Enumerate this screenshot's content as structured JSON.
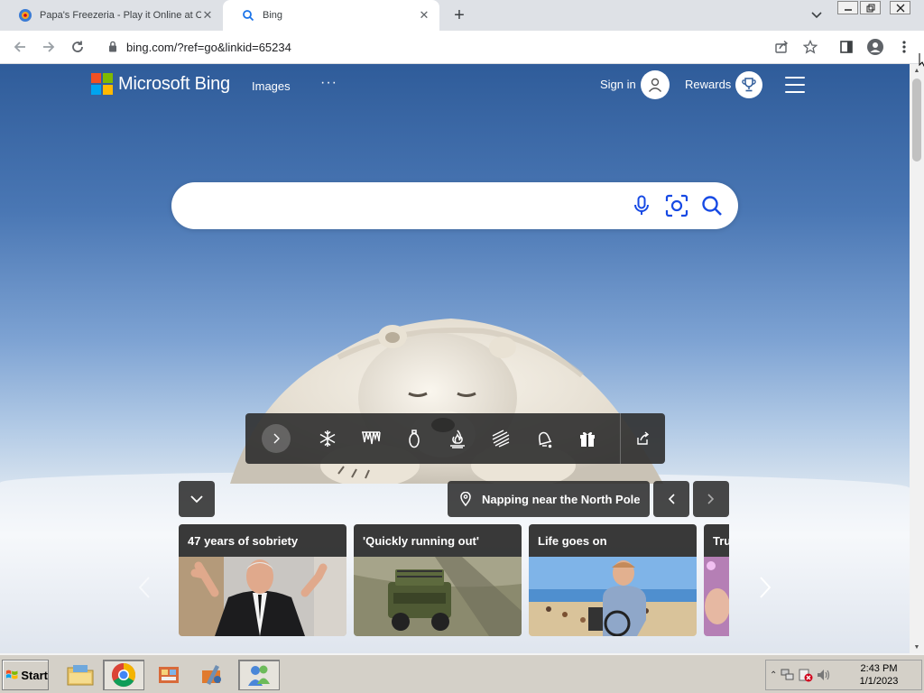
{
  "browser": {
    "tabs": [
      {
        "title": "Papa's Freezeria - Play it Online at C",
        "active": false
      },
      {
        "title": "Bing",
        "active": true
      }
    ],
    "new_tab_label": "+",
    "close_glyph": "✕",
    "url": "bing.com/?ref=go&linkid=65234"
  },
  "bing": {
    "brand": "Microsoft Bing",
    "nav": {
      "images": "Images",
      "more": "···"
    },
    "signin": "Sign in",
    "rewards": "Rewards",
    "search_placeholder": "",
    "iconbar_icons": [
      "chevron-right-icon",
      "snowflake-icon",
      "icicles-icon",
      "ornament-icon",
      "campfire-icon",
      "wind-icon",
      "bell-icon",
      "gift-icon",
      "share-icon"
    ],
    "location": "Napping near the North Pole",
    "cards": [
      {
        "title": "47 years of sobriety"
      },
      {
        "title": "'Quickly running out'"
      },
      {
        "title": "Life goes on"
      },
      {
        "title": "Trur"
      }
    ]
  },
  "colors": {
    "ms_red": "#f25022",
    "ms_green": "#7fba00",
    "ms_blue": "#00a4ef",
    "ms_yellow": "#ffb900",
    "bing_teal": "#174ae4"
  },
  "taskbar": {
    "start_label": "Start",
    "time": "2:43 PM",
    "date": "1/1/2023"
  }
}
